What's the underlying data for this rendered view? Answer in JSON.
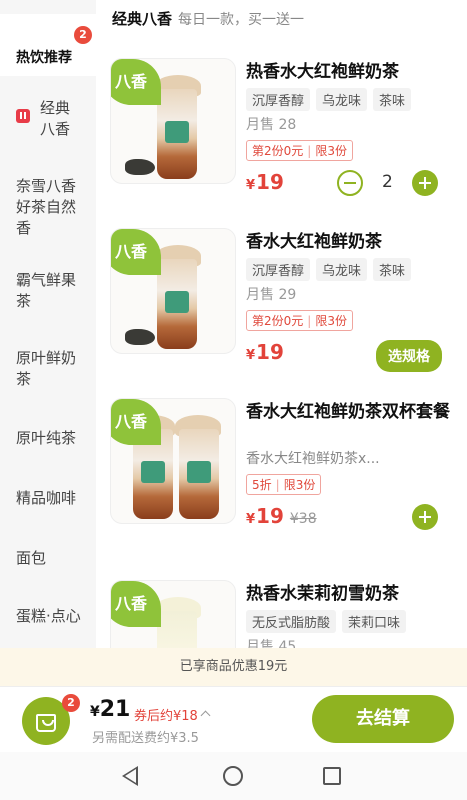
{
  "sidebar": {
    "items": [
      {
        "label": "热饮推荐",
        "badge": "2"
      },
      {
        "label": "经典八香"
      },
      {
        "label": "奈雪八香好茶自然香"
      },
      {
        "label": "霸气鲜果茶"
      },
      {
        "label": "原叶鲜奶茶"
      },
      {
        "label": "原叶纯茶"
      },
      {
        "label": "精品咖啡"
      },
      {
        "label": "面包"
      },
      {
        "label": "蛋糕·点心"
      }
    ]
  },
  "section": {
    "title": "经典八香",
    "subtitle": "每日一款，买一送一"
  },
  "products": [
    {
      "badge": "八香",
      "name": "热香水大红袍鲜奶茶",
      "tags": [
        "沉厚香醇",
        "乌龙味",
        "茶味"
      ],
      "sales": "月售 28",
      "promo": {
        "a": "第2份0元",
        "sep": "|",
        "b": "限3份"
      },
      "price": "19",
      "currency": "¥",
      "qty": "2"
    },
    {
      "badge": "八香",
      "name": "香水大红袍鲜奶茶",
      "tags": [
        "沉厚香醇",
        "乌龙味",
        "茶味"
      ],
      "sales": "月售 29",
      "promo": {
        "a": "第2份0元",
        "sep": "|",
        "b": "限3份"
      },
      "price": "19",
      "currency": "¥",
      "action": "选规格"
    },
    {
      "badge": "八香",
      "name": "香水大红袍鲜奶茶双杯套餐",
      "desc": "香水大红袍鲜奶茶x...",
      "promo": {
        "a": "5折",
        "sep": "|",
        "b": "限3份"
      },
      "price": "19",
      "currency": "¥",
      "original_price": "¥38"
    },
    {
      "badge": "八香",
      "name": "热香水茉莉初雪奶茶",
      "tags": [
        "无反式脂肪酸",
        "茉莉口味"
      ],
      "sales": "月售 45"
    }
  ],
  "discount_bar": "已享商品优惠19元",
  "cart": {
    "badge": "2",
    "currency": "¥",
    "total": "21",
    "coupon_after": "券后约¥18",
    "delivery": "另需配送费约¥3.5",
    "checkout": "去结算"
  },
  "colors": {
    "accent": "#8fb321",
    "price": "#e2433a",
    "badge": "#e94b3c"
  }
}
